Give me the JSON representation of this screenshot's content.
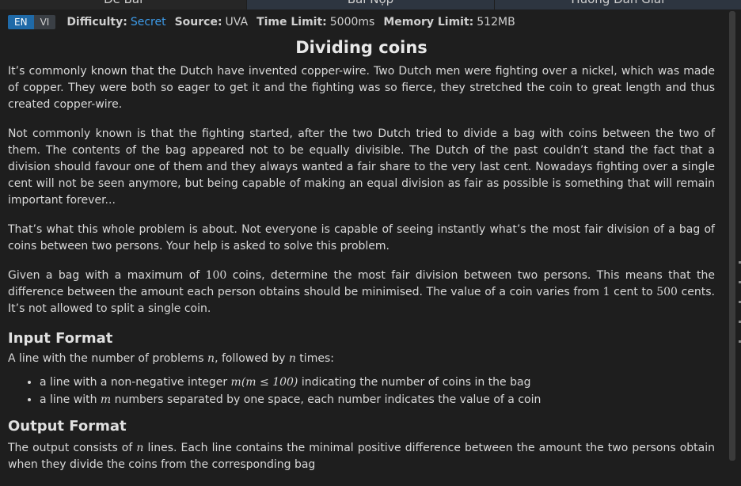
{
  "tabs": [
    {
      "label": "Đề Bài",
      "active": false
    },
    {
      "label": "Bài Nộp",
      "active": true
    },
    {
      "label": "Hướng Dẫn Giải",
      "active": false
    }
  ],
  "lang": {
    "en": "EN",
    "vi": "VI",
    "selected": "EN"
  },
  "meta": {
    "difficulty_label": "Difficulty:",
    "difficulty_value": "Secret",
    "source_label": "Source:",
    "source_value": "UVA",
    "time_label": "Time Limit:",
    "time_value": "5000ms",
    "memory_label": "Memory Limit:",
    "memory_value": "512MB"
  },
  "problem": {
    "title": "Dividing coins",
    "p1": "It’s commonly known that the Dutch have invented copper-wire. Two Dutch men were fighting over a nickel, which was made of copper. They were both so eager to get it and the fighting was so fierce, they stretched the coin to great length and thus created copper-wire.",
    "p2": "Not commonly known is that the fighting started, after the two Dutch tried to divide a bag with coins between the two of them. The contents of the bag appeared not to be equally divisible. The Dutch of the past couldn’t stand the fact that a division should favour one of them and they always wanted a fair share to the very last cent. Nowadays fighting over a single cent will not be seen anymore, but being capable of making an equal division as fair as possible is something that will remain important forever...",
    "p3": "That’s what this whole problem is about. Not everyone is capable of seeing instantly what’s the most fair division of a bag of coins between two persons. Your help is asked to solve this problem.",
    "p4_a": "Given a bag with a maximum of ",
    "p4_max": "100",
    "p4_b": " coins, determine the most fair division between two persons. This means that the difference between the amount each person obtains should be minimised. The value of a coin varies from ",
    "p4_min_val": "1",
    "p4_c": " cent to ",
    "p4_max_val": "500",
    "p4_d": " cents. It’s not allowed to split a single coin.",
    "input_heading": "Input Format",
    "input_a": "A line with the number of problems ",
    "input_n": "n",
    "input_b": ", followed by ",
    "input_n2": "n",
    "input_c": " times:",
    "bullet1_a": "a line with a non-negative integer ",
    "bullet1_math": "m(m ≤ 100)",
    "bullet1_b": " indicating the number of coins in the bag",
    "bullet2_a": "a line with ",
    "bullet2_math": "m",
    "bullet2_b": " numbers separated by one space, each number indicates the value of a coin",
    "output_heading": "Output Format",
    "output_a": "The output consists of ",
    "output_n": "n",
    "output_b": " lines. Each line contains the minimal positive difference between the amount the two persons obtain when they divide the coins from the corresponding bag"
  }
}
